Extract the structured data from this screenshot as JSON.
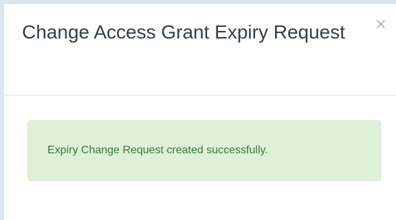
{
  "modal": {
    "title": "Change Access Grant Expiry Request",
    "close_label": "×"
  },
  "alert": {
    "message": "Expiry Change Request created successfully.",
    "type": "success"
  },
  "colors": {
    "alert_background": "#dff0d8",
    "alert_text": "#3c763d",
    "page_background": "#dde6ec"
  }
}
